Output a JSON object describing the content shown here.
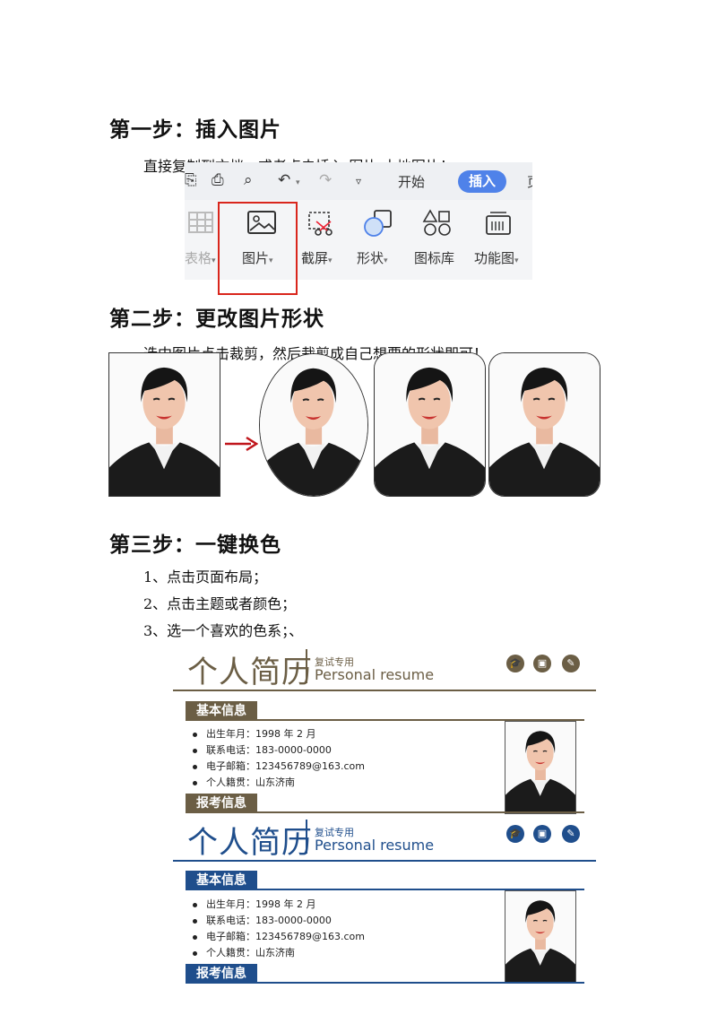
{
  "step1": {
    "heading": "第一步：插入图片",
    "text": "直接复制到文档，或者点击插入-图片-本地图片！"
  },
  "ribbon": {
    "tab_start": "开始",
    "tab_insert": "插入",
    "tool_table": "表格",
    "tool_picture": "图片",
    "tool_screenshot": "截屏",
    "tool_shape": "形状",
    "tool_iconlib": "图标库",
    "tool_funcmap": "功能图"
  },
  "step2": {
    "heading": "第二步：更改图片形状",
    "text": "选中图片点击裁剪，然后裁剪成自己想要的形状即可！"
  },
  "step3": {
    "heading": "第三步：一键换色",
    "items": [
      "1、点击页面布局；",
      "2、点击主题或者颜色；",
      "3、选一个喜欢的色系；、"
    ]
  },
  "resumes": [
    {
      "color": "#6b5e45",
      "title": "个人简历",
      "tag": "复试专用",
      "en": "Personal resume",
      "basic_label": "基本信息",
      "info": [
        "出生年月：1998 年 2 月",
        "联系电话：183-0000-0000",
        "电子邮箱：123456789@163.com",
        "个人籍贯：山东济南"
      ],
      "exam_label": "报考信息"
    },
    {
      "color": "#1f4e8c",
      "title": "个人简历",
      "tag": "复试专用",
      "en": "Personal resume",
      "basic_label": "基本信息",
      "info": [
        "出生年月：1998 年 2 月",
        "联系电话：183-0000-0000",
        "电子邮箱：123456789@163.com",
        "个人籍贯：山东济南"
      ],
      "exam_label": "报考信息"
    }
  ],
  "colors": {
    "accent_red": "#d9261c",
    "ribbon_blue": "#4f82e9"
  }
}
